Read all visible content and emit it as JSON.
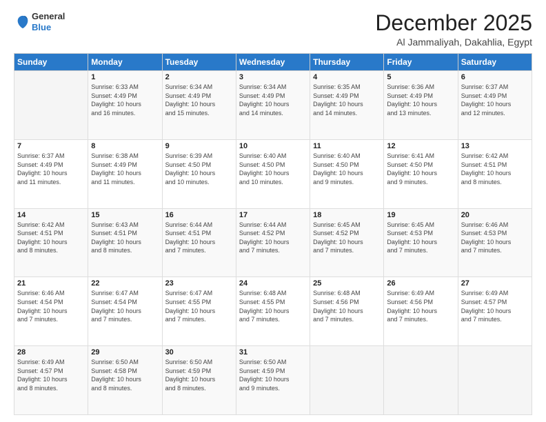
{
  "header": {
    "logo": {
      "line1": "General",
      "line2": "Blue"
    },
    "month": "December 2025",
    "location": "Al Jammaliyah, Dakahlia, Egypt"
  },
  "weekdays": [
    "Sunday",
    "Monday",
    "Tuesday",
    "Wednesday",
    "Thursday",
    "Friday",
    "Saturday"
  ],
  "weeks": [
    [
      {
        "day": "",
        "info": ""
      },
      {
        "day": "1",
        "info": "Sunrise: 6:33 AM\nSunset: 4:49 PM\nDaylight: 10 hours\nand 16 minutes."
      },
      {
        "day": "2",
        "info": "Sunrise: 6:34 AM\nSunset: 4:49 PM\nDaylight: 10 hours\nand 15 minutes."
      },
      {
        "day": "3",
        "info": "Sunrise: 6:34 AM\nSunset: 4:49 PM\nDaylight: 10 hours\nand 14 minutes."
      },
      {
        "day": "4",
        "info": "Sunrise: 6:35 AM\nSunset: 4:49 PM\nDaylight: 10 hours\nand 14 minutes."
      },
      {
        "day": "5",
        "info": "Sunrise: 6:36 AM\nSunset: 4:49 PM\nDaylight: 10 hours\nand 13 minutes."
      },
      {
        "day": "6",
        "info": "Sunrise: 6:37 AM\nSunset: 4:49 PM\nDaylight: 10 hours\nand 12 minutes."
      }
    ],
    [
      {
        "day": "7",
        "info": "Sunrise: 6:37 AM\nSunset: 4:49 PM\nDaylight: 10 hours\nand 11 minutes."
      },
      {
        "day": "8",
        "info": "Sunrise: 6:38 AM\nSunset: 4:49 PM\nDaylight: 10 hours\nand 11 minutes."
      },
      {
        "day": "9",
        "info": "Sunrise: 6:39 AM\nSunset: 4:50 PM\nDaylight: 10 hours\nand 10 minutes."
      },
      {
        "day": "10",
        "info": "Sunrise: 6:40 AM\nSunset: 4:50 PM\nDaylight: 10 hours\nand 10 minutes."
      },
      {
        "day": "11",
        "info": "Sunrise: 6:40 AM\nSunset: 4:50 PM\nDaylight: 10 hours\nand 9 minutes."
      },
      {
        "day": "12",
        "info": "Sunrise: 6:41 AM\nSunset: 4:50 PM\nDaylight: 10 hours\nand 9 minutes."
      },
      {
        "day": "13",
        "info": "Sunrise: 6:42 AM\nSunset: 4:51 PM\nDaylight: 10 hours\nand 8 minutes."
      }
    ],
    [
      {
        "day": "14",
        "info": "Sunrise: 6:42 AM\nSunset: 4:51 PM\nDaylight: 10 hours\nand 8 minutes."
      },
      {
        "day": "15",
        "info": "Sunrise: 6:43 AM\nSunset: 4:51 PM\nDaylight: 10 hours\nand 8 minutes."
      },
      {
        "day": "16",
        "info": "Sunrise: 6:44 AM\nSunset: 4:51 PM\nDaylight: 10 hours\nand 7 minutes."
      },
      {
        "day": "17",
        "info": "Sunrise: 6:44 AM\nSunset: 4:52 PM\nDaylight: 10 hours\nand 7 minutes."
      },
      {
        "day": "18",
        "info": "Sunrise: 6:45 AM\nSunset: 4:52 PM\nDaylight: 10 hours\nand 7 minutes."
      },
      {
        "day": "19",
        "info": "Sunrise: 6:45 AM\nSunset: 4:53 PM\nDaylight: 10 hours\nand 7 minutes."
      },
      {
        "day": "20",
        "info": "Sunrise: 6:46 AM\nSunset: 4:53 PM\nDaylight: 10 hours\nand 7 minutes."
      }
    ],
    [
      {
        "day": "21",
        "info": "Sunrise: 6:46 AM\nSunset: 4:54 PM\nDaylight: 10 hours\nand 7 minutes."
      },
      {
        "day": "22",
        "info": "Sunrise: 6:47 AM\nSunset: 4:54 PM\nDaylight: 10 hours\nand 7 minutes."
      },
      {
        "day": "23",
        "info": "Sunrise: 6:47 AM\nSunset: 4:55 PM\nDaylight: 10 hours\nand 7 minutes."
      },
      {
        "day": "24",
        "info": "Sunrise: 6:48 AM\nSunset: 4:55 PM\nDaylight: 10 hours\nand 7 minutes."
      },
      {
        "day": "25",
        "info": "Sunrise: 6:48 AM\nSunset: 4:56 PM\nDaylight: 10 hours\nand 7 minutes."
      },
      {
        "day": "26",
        "info": "Sunrise: 6:49 AM\nSunset: 4:56 PM\nDaylight: 10 hours\nand 7 minutes."
      },
      {
        "day": "27",
        "info": "Sunrise: 6:49 AM\nSunset: 4:57 PM\nDaylight: 10 hours\nand 7 minutes."
      }
    ],
    [
      {
        "day": "28",
        "info": "Sunrise: 6:49 AM\nSunset: 4:57 PM\nDaylight: 10 hours\nand 8 minutes."
      },
      {
        "day": "29",
        "info": "Sunrise: 6:50 AM\nSunset: 4:58 PM\nDaylight: 10 hours\nand 8 minutes."
      },
      {
        "day": "30",
        "info": "Sunrise: 6:50 AM\nSunset: 4:59 PM\nDaylight: 10 hours\nand 8 minutes."
      },
      {
        "day": "31",
        "info": "Sunrise: 6:50 AM\nSunset: 4:59 PM\nDaylight: 10 hours\nand 9 minutes."
      },
      {
        "day": "",
        "info": ""
      },
      {
        "day": "",
        "info": ""
      },
      {
        "day": "",
        "info": ""
      }
    ]
  ]
}
